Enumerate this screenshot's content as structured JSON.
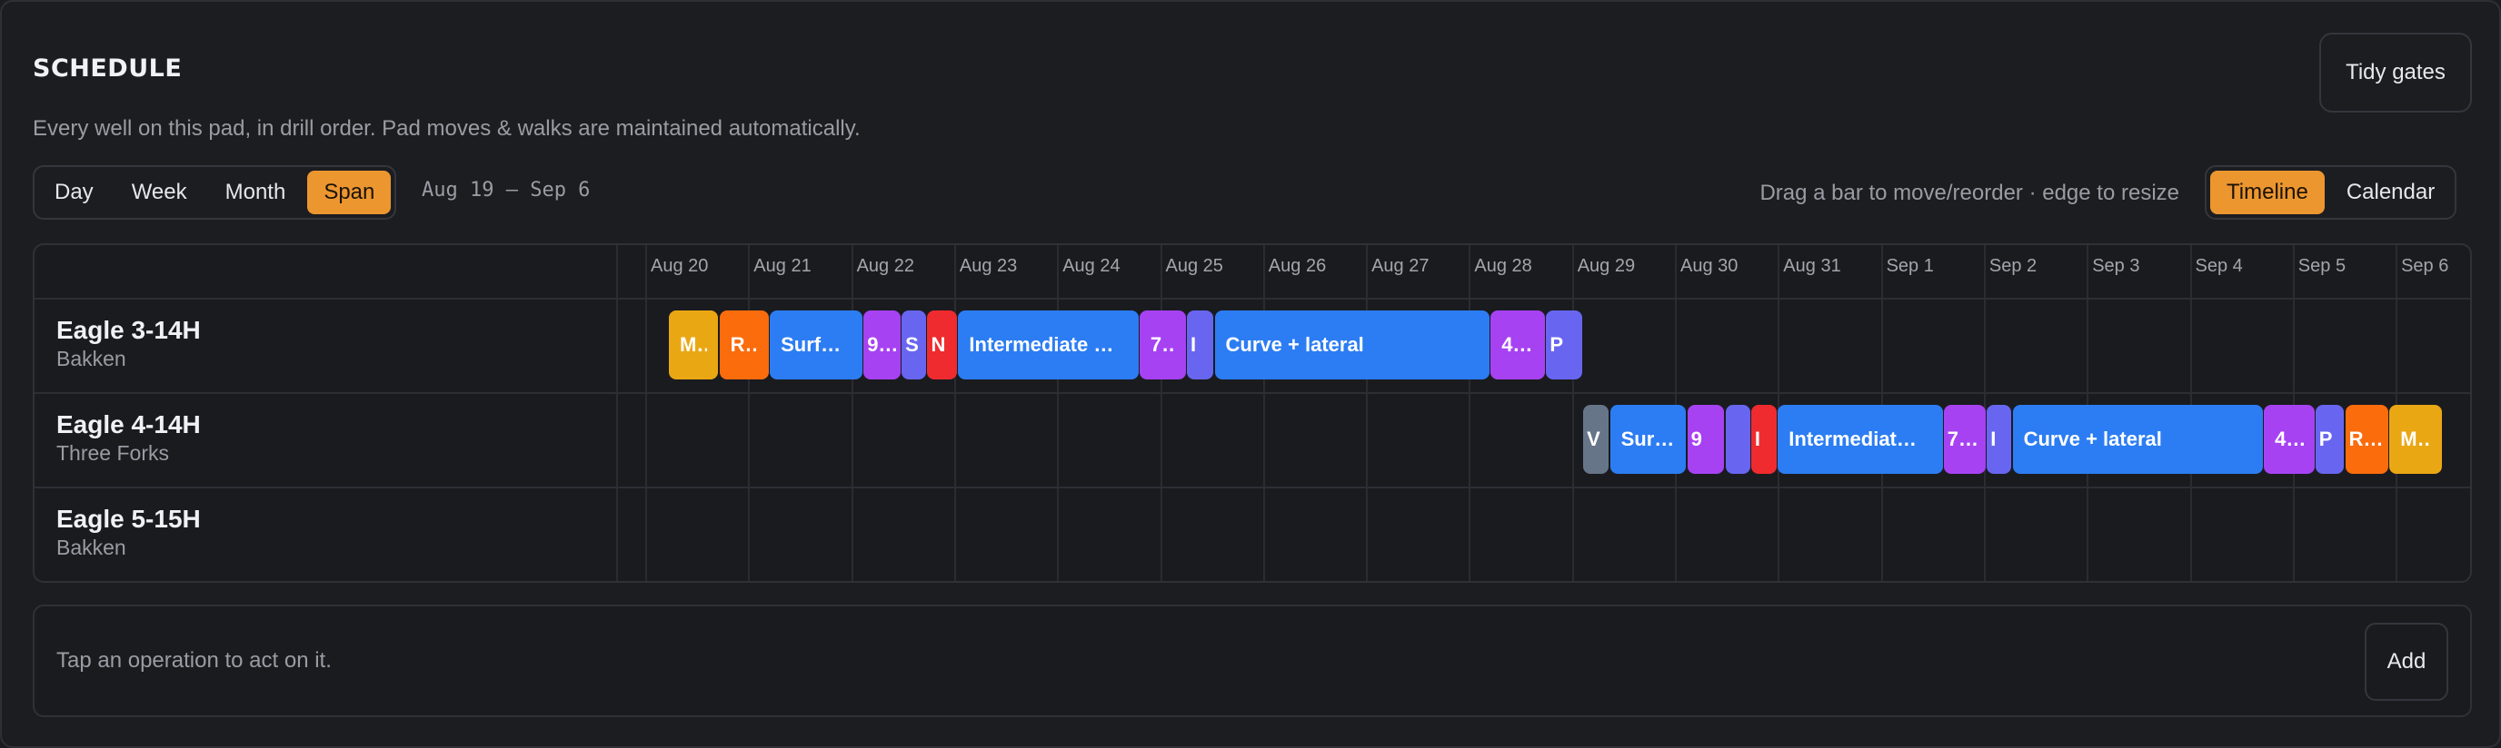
{
  "header": {
    "title": "SCHEDULE",
    "subtitle": "Every well on this pad, in drill order. Pad moves & walks are maintained automatically.",
    "tidy_label": "Tidy gates"
  },
  "range_tabs": [
    {
      "label": "Day",
      "active": false
    },
    {
      "label": "Week",
      "active": false
    },
    {
      "label": "Month",
      "active": false
    },
    {
      "label": "Span",
      "active": true
    }
  ],
  "date_range": "Aug 19 – Sep 6",
  "hint": "Drag a bar to move/reorder · edge to resize",
  "view_tabs": [
    {
      "label": "Timeline",
      "active": true
    },
    {
      "label": "Calendar",
      "active": false
    }
  ],
  "days": [
    "Aug 20",
    "Aug 21",
    "Aug 22",
    "Aug 23",
    "Aug 24",
    "Aug 25",
    "Aug 26",
    "Aug 27",
    "Aug 28",
    "Aug 29",
    "Aug 30",
    "Aug 31",
    "Sep 1",
    "Sep 2",
    "Sep 3",
    "Sep 4",
    "Sep 5",
    "Sep 6"
  ],
  "colors": {
    "yellow": "#eaa714",
    "orange": "#fb6c0c",
    "blue": "#2c7df3",
    "purple": "#a742f3",
    "indigo": "#6866f0",
    "red": "#ef2b2f",
    "slate": "#677589"
  },
  "wells": [
    {
      "name": "Eagle 3-14H",
      "formation": "Bakken",
      "ops": [
        {
          "label": "M…",
          "color": "yellow",
          "start": 0.23,
          "end": 0.71
        },
        {
          "label": "R…",
          "color": "orange",
          "start": 0.72,
          "end": 1.2
        },
        {
          "label": "Surfa…",
          "color": "blue",
          "start": 1.21,
          "end": 2.11
        },
        {
          "label": "9…",
          "color": "purple",
          "start": 2.12,
          "end": 2.48
        },
        {
          "label": "S",
          "color": "indigo",
          "start": 2.49,
          "end": 2.73
        },
        {
          "label": "N",
          "color": "red",
          "start": 2.74,
          "end": 3.03
        },
        {
          "label": "Intermediate …",
          "color": "blue",
          "start": 3.04,
          "end": 4.79
        },
        {
          "label": "7…",
          "color": "purple",
          "start": 4.8,
          "end": 5.25
        },
        {
          "label": "I",
          "color": "indigo",
          "start": 5.26,
          "end": 5.52
        },
        {
          "label": "Curve + lateral",
          "color": "blue",
          "start": 5.53,
          "end": 8.2
        },
        {
          "label": "4…",
          "color": "purple",
          "start": 8.21,
          "end": 8.74
        },
        {
          "label": "P",
          "color": "indigo",
          "start": 8.75,
          "end": 9.1
        }
      ]
    },
    {
      "name": "Eagle 4-14H",
      "formation": "Three Forks",
      "ops": [
        {
          "label": "V",
          "color": "slate",
          "start": 9.11,
          "end": 9.36
        },
        {
          "label": "Sur…",
          "color": "blue",
          "start": 9.37,
          "end": 10.11
        },
        {
          "label": "9",
          "color": "purple",
          "start": 10.12,
          "end": 10.48
        },
        {
          "label": "",
          "color": "indigo",
          "start": 10.49,
          "end": 10.73
        },
        {
          "label": "I",
          "color": "red",
          "start": 10.74,
          "end": 10.99
        },
        {
          "label": "Intermediat…",
          "color": "blue",
          "start": 11.0,
          "end": 12.6
        },
        {
          "label": "7…",
          "color": "purple",
          "start": 12.61,
          "end": 13.02
        },
        {
          "label": "I",
          "color": "indigo",
          "start": 13.03,
          "end": 13.27
        },
        {
          "label": "Curve + lateral",
          "color": "blue",
          "start": 13.28,
          "end": 15.71
        },
        {
          "label": "4…",
          "color": "purple",
          "start": 15.72,
          "end": 16.21
        },
        {
          "label": "P",
          "color": "indigo",
          "start": 16.22,
          "end": 16.5
        },
        {
          "label": "R…",
          "color": "orange",
          "start": 16.51,
          "end": 16.93
        },
        {
          "label": "M…",
          "color": "yellow",
          "start": 16.94,
          "end": 17.45
        }
      ]
    },
    {
      "name": "Eagle 5-15H",
      "formation": "Bakken",
      "ops": []
    }
  ],
  "footer": {
    "hint": "Tap an operation to act on it.",
    "add_label": "Add"
  }
}
